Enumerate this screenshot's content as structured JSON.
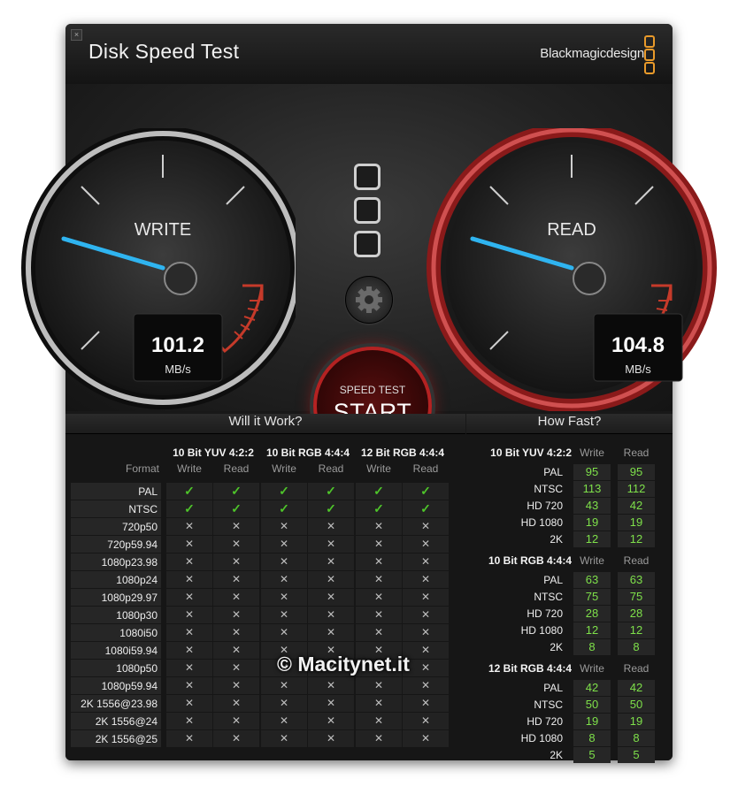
{
  "window": {
    "title": "Disk Speed Test",
    "brand": "Blackmagicdesign",
    "close_label": "×"
  },
  "write_gauge": {
    "label": "WRITE",
    "value": "101.2",
    "unit": "MB/s"
  },
  "read_gauge": {
    "label": "READ",
    "value": "104.8",
    "unit": "MB/s"
  },
  "start_button": {
    "sub": "SPEED TEST",
    "main": "START"
  },
  "will_it_work": {
    "heading": "Will it Work?",
    "format_label": "Format",
    "groups": [
      "10 Bit YUV 4:2:2",
      "10 Bit RGB 4:4:4",
      "12 Bit RGB 4:4:4"
    ],
    "sub_headers": [
      "Write",
      "Read",
      "Write",
      "Read",
      "Write",
      "Read"
    ],
    "rows": [
      {
        "format": "PAL",
        "cells": [
          true,
          true,
          true,
          true,
          true,
          true
        ]
      },
      {
        "format": "NTSC",
        "cells": [
          true,
          true,
          true,
          true,
          true,
          true
        ]
      },
      {
        "format": "720p50",
        "cells": [
          false,
          false,
          false,
          false,
          false,
          false
        ]
      },
      {
        "format": "720p59.94",
        "cells": [
          false,
          false,
          false,
          false,
          false,
          false
        ]
      },
      {
        "format": "1080p23.98",
        "cells": [
          false,
          false,
          false,
          false,
          false,
          false
        ]
      },
      {
        "format": "1080p24",
        "cells": [
          false,
          false,
          false,
          false,
          false,
          false
        ]
      },
      {
        "format": "1080p29.97",
        "cells": [
          false,
          false,
          false,
          false,
          false,
          false
        ]
      },
      {
        "format": "1080p30",
        "cells": [
          false,
          false,
          false,
          false,
          false,
          false
        ]
      },
      {
        "format": "1080i50",
        "cells": [
          false,
          false,
          false,
          false,
          false,
          false
        ]
      },
      {
        "format": "1080i59.94",
        "cells": [
          false,
          false,
          false,
          false,
          false,
          false
        ]
      },
      {
        "format": "1080p50",
        "cells": [
          false,
          false,
          false,
          false,
          false,
          false
        ]
      },
      {
        "format": "1080p59.94",
        "cells": [
          false,
          false,
          false,
          false,
          false,
          false
        ]
      },
      {
        "format": "2K 1556@23.98",
        "cells": [
          false,
          false,
          false,
          false,
          false,
          false
        ]
      },
      {
        "format": "2K 1556@24",
        "cells": [
          false,
          false,
          false,
          false,
          false,
          false
        ]
      },
      {
        "format": "2K 1556@25",
        "cells": [
          false,
          false,
          false,
          false,
          false,
          false
        ]
      }
    ],
    "ok_glyph": "✓",
    "no_glyph": "✕"
  },
  "how_fast": {
    "heading": "How Fast?",
    "sections": [
      {
        "name": "10 Bit YUV 4:2:2",
        "write_label": "Write",
        "read_label": "Read",
        "rows": [
          {
            "format": "PAL",
            "write": "95",
            "read": "95"
          },
          {
            "format": "NTSC",
            "write": "113",
            "read": "112"
          },
          {
            "format": "HD 720",
            "write": "43",
            "read": "42"
          },
          {
            "format": "HD 1080",
            "write": "19",
            "read": "19"
          },
          {
            "format": "2K",
            "write": "12",
            "read": "12"
          }
        ]
      },
      {
        "name": "10 Bit RGB 4:4:4",
        "write_label": "Write",
        "read_label": "Read",
        "rows": [
          {
            "format": "PAL",
            "write": "63",
            "read": "63"
          },
          {
            "format": "NTSC",
            "write": "75",
            "read": "75"
          },
          {
            "format": "HD 720",
            "write": "28",
            "read": "28"
          },
          {
            "format": "HD 1080",
            "write": "12",
            "read": "12"
          },
          {
            "format": "2K",
            "write": "8",
            "read": "8"
          }
        ]
      },
      {
        "name": "12 Bit RGB 4:4:4",
        "write_label": "Write",
        "read_label": "Read",
        "rows": [
          {
            "format": "PAL",
            "write": "42",
            "read": "42"
          },
          {
            "format": "NTSC",
            "write": "50",
            "read": "50"
          },
          {
            "format": "HD 720",
            "write": "19",
            "read": "19"
          },
          {
            "format": "HD 1080",
            "write": "8",
            "read": "8"
          },
          {
            "format": "2K",
            "write": "5",
            "read": "5"
          }
        ]
      }
    ]
  },
  "watermark": "© Macitynet.it",
  "colors": {
    "write_needle": "#2fb4f0",
    "read_needle": "#2fb4f0",
    "read_ring": "#c02424",
    "ok": "#4ec42a",
    "speed_value": "#7ee04a"
  }
}
